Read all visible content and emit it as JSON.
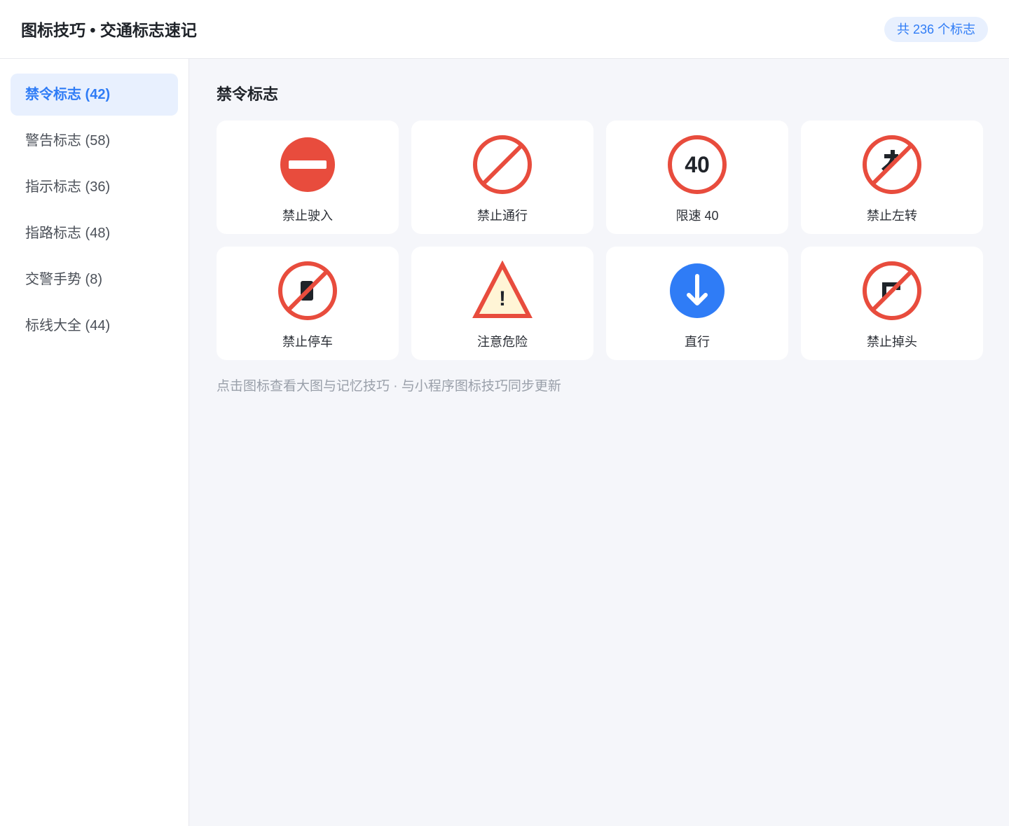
{
  "header": {
    "title": "图标技巧 • 交通标志速记",
    "count_badge": "共 236 个标志"
  },
  "sidebar": {
    "items": [
      {
        "label": "禁令标志 (42)",
        "active": true
      },
      {
        "label": "警告标志 (58)",
        "active": false
      },
      {
        "label": "指示标志 (36)",
        "active": false
      },
      {
        "label": "指路标志 (48)",
        "active": false
      },
      {
        "label": "交警手势 (8)",
        "active": false
      },
      {
        "label": "标线大全 (44)",
        "active": false
      }
    ]
  },
  "main": {
    "section_title": "禁令标志",
    "cards": [
      {
        "label": "禁止驶入",
        "icon": "no-entry-icon"
      },
      {
        "label": "禁止通行",
        "icon": "no-passing-icon"
      },
      {
        "label": "限速 40",
        "icon": "speed-limit-icon",
        "sign_text": "40"
      },
      {
        "label": "禁止左转",
        "icon": "no-left-turn-icon"
      },
      {
        "label": "禁止停车",
        "icon": "no-parking-icon"
      },
      {
        "label": "注意危险",
        "icon": "danger-warning-icon",
        "sign_text": "!"
      },
      {
        "label": "直行",
        "icon": "go-straight-icon"
      },
      {
        "label": "禁止掉头",
        "icon": "no-u-turn-icon"
      }
    ],
    "footnote": "点击图标查看大图与记忆技巧 · 与小程序图标技巧同步更新"
  },
  "colors": {
    "accent": "#2f7cf6",
    "sign_red": "#e84c3d",
    "sign_blue": "#2f7cf6",
    "warning_fill": "#fff5d6"
  }
}
